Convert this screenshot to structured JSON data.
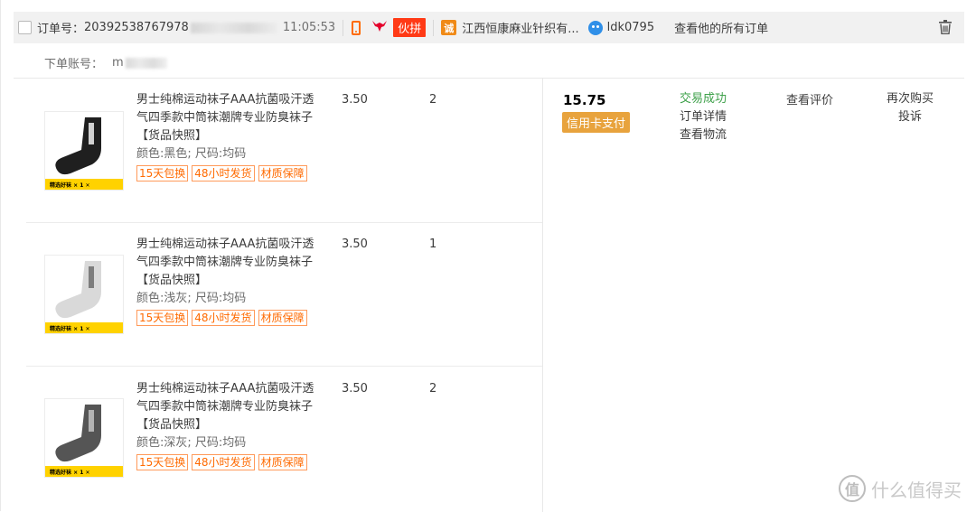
{
  "header": {
    "order_label": "订单号：",
    "order_number": "20392538767978",
    "time": "11:05:53",
    "partner_badge": "伙拼",
    "shop_icon_text": "诚",
    "shop_name": "江西恒康麻业针织有...",
    "seller_name": "ldk0795",
    "all_orders_link": "查看他的所有订单"
  },
  "account": {
    "label": "下单账号：",
    "value": "m"
  },
  "items": [
    {
      "title": "男士纯棉运动袜子AAA抗菌吸汗透气四季款中筒袜潮牌专业防臭袜子",
      "snapshot": "【货品快照】",
      "sku": "颜色:黑色; 尺码:均码",
      "tags": [
        "15天包换",
        "48小时发货",
        "材质保障"
      ],
      "price": "3.50",
      "qty": "2",
      "sock_color": "#1f1f1f",
      "band_text": "精选好袜 × 1 ✕"
    },
    {
      "title": "男士纯棉运动袜子AAA抗菌吸汗透气四季款中筒袜潮牌专业防臭袜子",
      "snapshot": "【货品快照】",
      "sku": "颜色:浅灰; 尺码:均码",
      "tags": [
        "15天包换",
        "48小时发货",
        "材质保障"
      ],
      "price": "3.50",
      "qty": "1",
      "sock_color": "#d9d9d9",
      "band_text": "精选好袜 × 1 ✕"
    },
    {
      "title": "男士纯棉运动袜子AAA抗菌吸汗透气四季款中筒袜潮牌专业防臭袜子",
      "snapshot": "【货品快照】",
      "sku": "颜色:深灰; 尺码:均码",
      "tags": [
        "15天包换",
        "48小时发货",
        "材质保障"
      ],
      "price": "3.50",
      "qty": "2",
      "sock_color": "#555555",
      "band_text": "精选好袜 × 1 ✕"
    }
  ],
  "summary": {
    "total": "15.75",
    "payment": "信用卡支付",
    "status": "交易成功",
    "order_detail": "订单详情",
    "logistics": "查看物流",
    "review": "查看评价",
    "rebuy": "再次购买",
    "complain": "投诉"
  },
  "watermark": {
    "icon_text": "值",
    "text": "什么值得买"
  }
}
